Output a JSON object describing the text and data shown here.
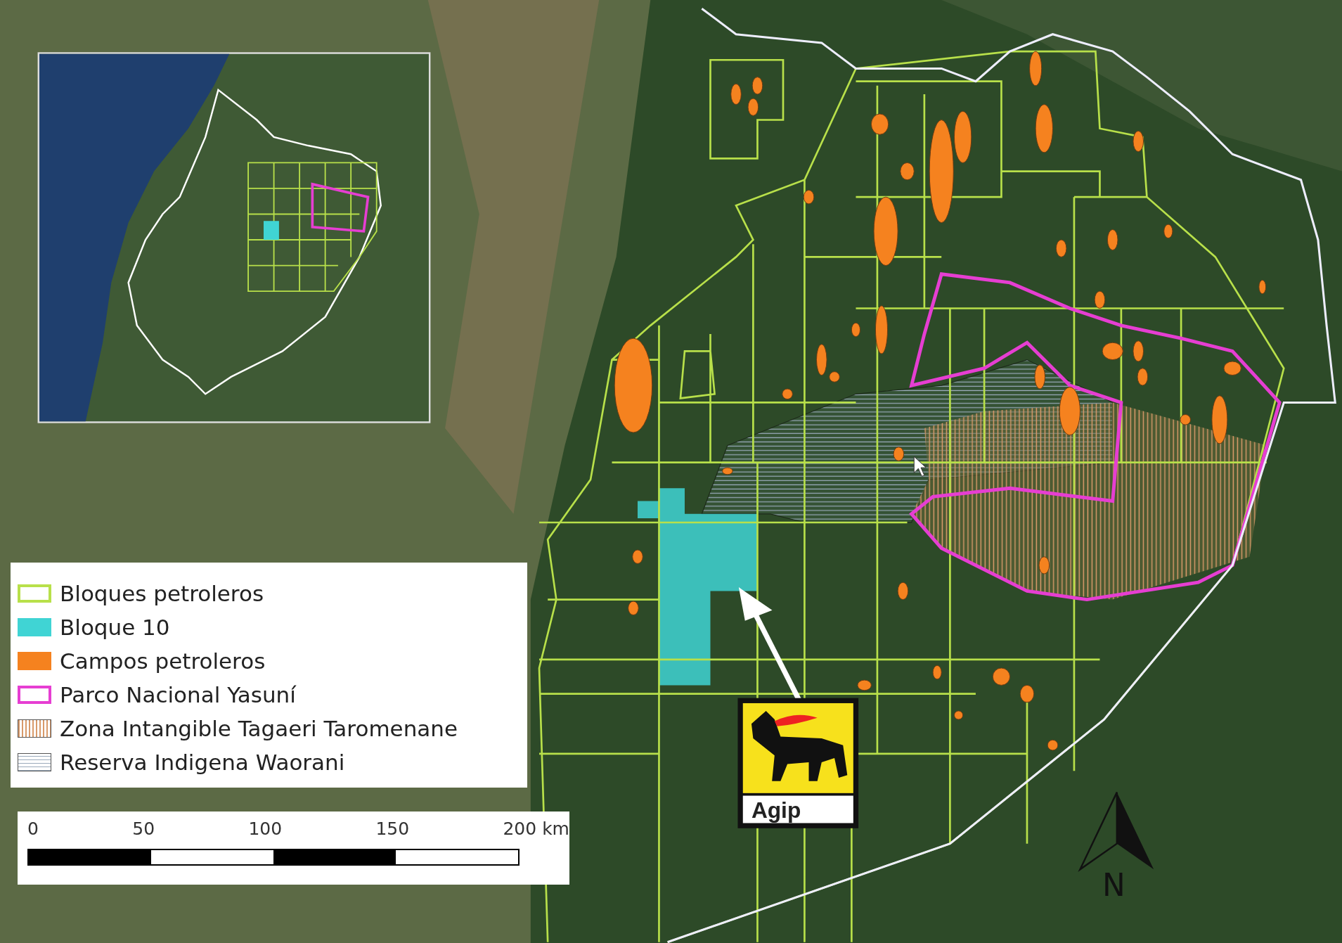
{
  "map": {
    "legend": [
      {
        "label": "Bloques petroleros",
        "kind": "outline",
        "color": "#b8e04a"
      },
      {
        "label": "Bloque 10",
        "kind": "fill",
        "color": "#40d4d4"
      },
      {
        "label": "Campos petroleros",
        "kind": "fill",
        "color": "#f5821f"
      },
      {
        "label": "Parco Nacional Yasuní",
        "kind": "outline",
        "color": "#e63ed2"
      },
      {
        "label": "Zona Intangible Tagaeri Taromenane",
        "kind": "vertical-hatch",
        "color": "#d89a6a"
      },
      {
        "label": "Reserva Indigena Waorani",
        "kind": "horizontal-hatch",
        "color": "#9aaabb"
      }
    ],
    "scale_bar": {
      "labels": [
        "0",
        "50",
        "100",
        "150",
        "200 km"
      ]
    },
    "logo": {
      "text": "Agip"
    },
    "north_arrow": {
      "label": "N"
    }
  }
}
